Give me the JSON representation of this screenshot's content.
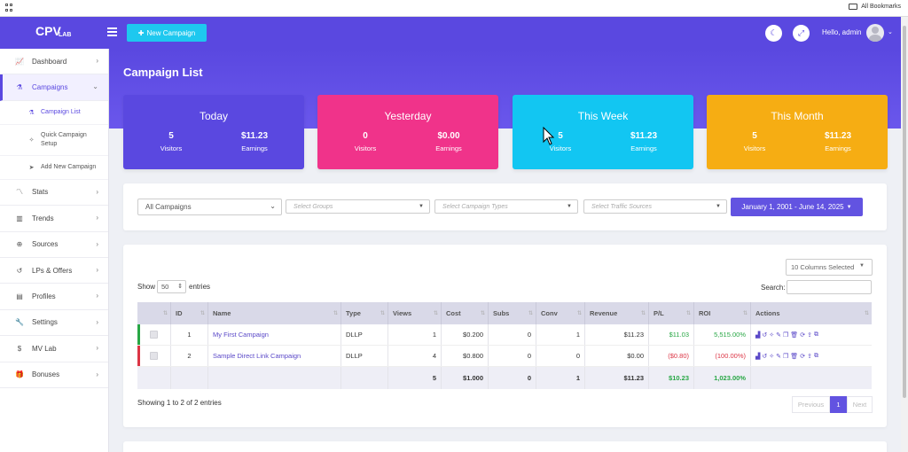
{
  "browser": {
    "all_bookmarks": "All Bookmarks"
  },
  "header": {
    "logo_main": "CPV",
    "logo_sub": "LAB",
    "new_campaign": "New Campaign",
    "hello": "Hello, admin"
  },
  "sidebar": {
    "items": [
      {
        "label": "Dashboard",
        "icon": "chart-icon"
      },
      {
        "label": "Campaigns",
        "icon": "flask-icon"
      },
      {
        "label": "Stats",
        "icon": "stats-icon"
      },
      {
        "label": "Trends",
        "icon": "trends-icon"
      },
      {
        "label": "Sources",
        "icon": "globe-icon"
      },
      {
        "label": "LPs & Offers",
        "icon": "history-icon"
      },
      {
        "label": "Profiles",
        "icon": "clipboard-icon"
      },
      {
        "label": "Settings",
        "icon": "wrench-icon"
      },
      {
        "label": "MV Lab",
        "icon": "dollar-icon"
      },
      {
        "label": "Bonuses",
        "icon": "gift-icon"
      }
    ],
    "sub": [
      {
        "label": "Campaign List"
      },
      {
        "label": "Quick Campaign Setup"
      },
      {
        "label": "Add New Campaign"
      }
    ]
  },
  "page": {
    "title": "Campaign List"
  },
  "cards": [
    {
      "title": "Today",
      "visitors": "5",
      "earnings": "$11.23",
      "color": "#5a48e0"
    },
    {
      "title": "Yesterday",
      "visitors": "0",
      "earnings": "$0.00",
      "color": "#f0338a"
    },
    {
      "title": "This Week",
      "visitors": "5",
      "earnings": "$11.23",
      "color": "#12c6f2"
    },
    {
      "title": "This Month",
      "visitors": "5",
      "earnings": "$11.23",
      "color": "#f6ad13"
    }
  ],
  "labels": {
    "visitors": "Visitors",
    "earnings": "Earnings"
  },
  "filters": {
    "campaigns": "All Campaigns",
    "groups": "Select Groups",
    "types": "Select Campaign Types",
    "sources": "Select Traffic Sources",
    "daterange": "January 1, 2001 - June 14, 2025"
  },
  "table_controls": {
    "columns": "10 Columns Selected",
    "show": "Show",
    "page_size": "50",
    "entries": "entries",
    "search": "Search:"
  },
  "table": {
    "headers": [
      "",
      "ID",
      "Name",
      "Type",
      "Views",
      "Cost",
      "Subs",
      "Conv",
      "Revenue",
      "P/L",
      "ROI",
      "Actions"
    ],
    "rows": [
      {
        "id": "1",
        "name": "My First Campaign",
        "type": "DLLP",
        "views": "1",
        "cost": "$0.200",
        "subs": "0",
        "conv": "1",
        "revenue": "$11.23",
        "pl": "$11.03",
        "roi": "5,515.00%"
      },
      {
        "id": "2",
        "name": "Sample Direct Link Campaign",
        "type": "DLLP",
        "views": "4",
        "cost": "$0.800",
        "subs": "0",
        "conv": "0",
        "revenue": "$0.00",
        "pl": "($0.80)",
        "roi": "(100.00%)"
      }
    ],
    "totals": {
      "views": "5",
      "cost": "$1.000",
      "subs": "0",
      "conv": "1",
      "revenue": "$11.23",
      "pl": "$10.23",
      "roi": "1,023.00%"
    }
  },
  "footer": {
    "showing": "Showing 1 to 2 of 2 entries",
    "previous": "Previous",
    "page": "1",
    "next": "Next"
  }
}
